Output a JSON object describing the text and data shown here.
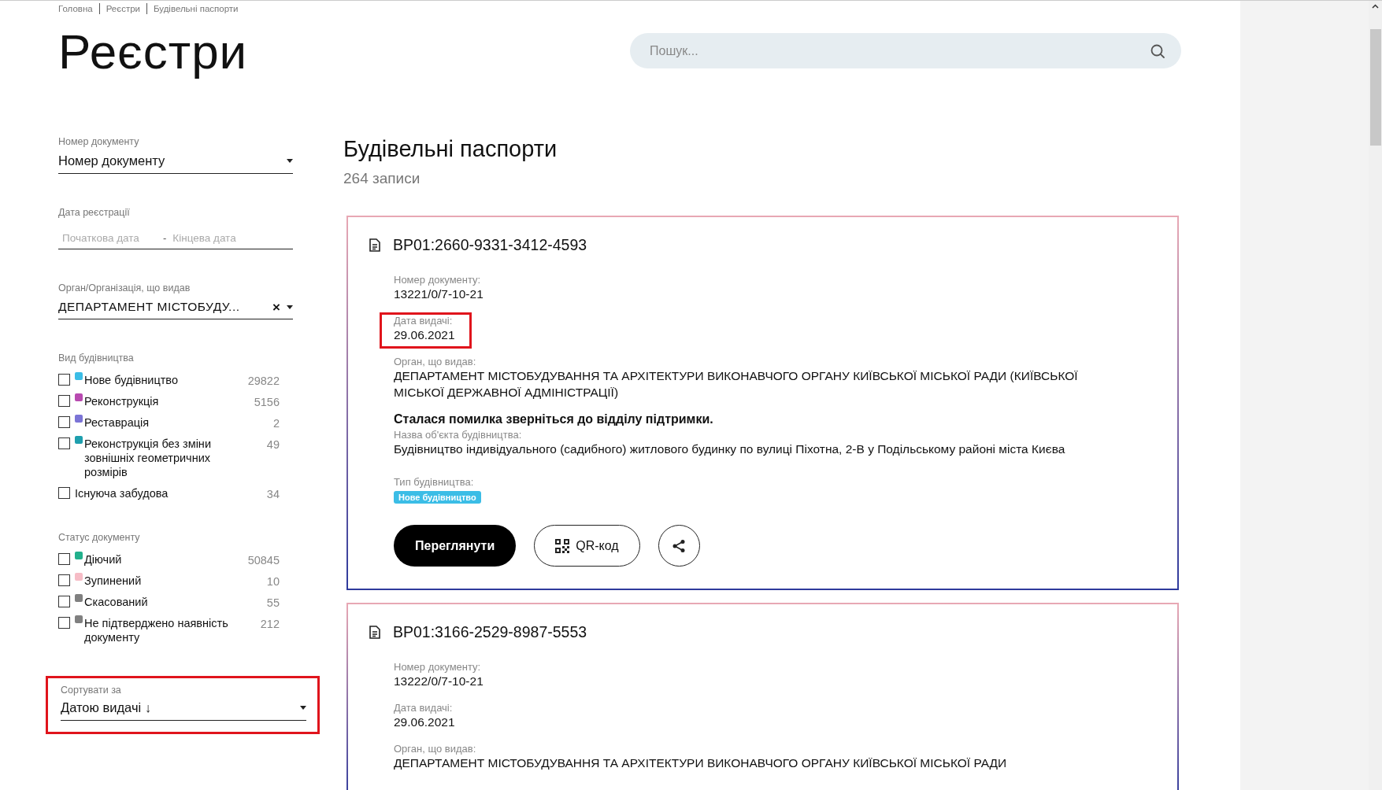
{
  "breadcrumbs": [
    "Головна",
    "Реєстри",
    "Будівельні паспорти"
  ],
  "page_title": "Реєстри",
  "search": {
    "placeholder": "Пошук..."
  },
  "filters": {
    "doc_number": {
      "label": "Номер документу",
      "value": "Номер документу"
    },
    "reg_date": {
      "label": "Дата реєстрації",
      "from_placeholder": "Початкова дата",
      "separator": "-",
      "to_placeholder": "Кінцева дата"
    },
    "issuer": {
      "label": "Орган/Організація, що видав",
      "value": "ДЕПАРТАМЕНТ МІСТОБУДУ...",
      "clear": "×"
    },
    "groups": [
      {
        "title": "Вид будівництва",
        "items": [
          {
            "label": "Нове будівництво",
            "count": "29822",
            "color": "#3bbde6",
            "checked": false
          },
          {
            "label": "Реконструкція",
            "count": "5156",
            "color": "#b84ab0",
            "checked": false
          },
          {
            "label": "Реставрація",
            "count": "2",
            "color": "#7b74d6",
            "checked": false
          },
          {
            "label": "Реконструкція без зміни зовнішніх геометричних розмірів",
            "count": "49",
            "color": "#1e9fae",
            "checked": false
          },
          {
            "label": "Існуюча забудова",
            "count": "34",
            "checked": false
          }
        ]
      },
      {
        "title": "Статус документу",
        "items": [
          {
            "label": "Діючий",
            "count": "50845",
            "color": "#22b08c",
            "checked": false
          },
          {
            "label": "Зупинений",
            "count": "10",
            "color": "#f6bcc6",
            "checked": false
          },
          {
            "label": "Скасований",
            "count": "55",
            "color": "#808080",
            "checked": false
          },
          {
            "label": "Не підтверджено наявність документу",
            "count": "212",
            "color": "#808080",
            "checked": false
          }
        ]
      }
    ],
    "sort": {
      "label": "Сортувати за",
      "value": "Датою видачі ↓",
      "highlighted": true
    }
  },
  "results": {
    "title": "Будівельні паспорти",
    "count": "264 записи",
    "cards": [
      {
        "id": "BP01:2660-9331-3412-4593",
        "fields": [
          {
            "label": "Номер документу:",
            "value": "13221/0/7-10-21",
            "highlighted": false
          },
          {
            "label": "Дата видачі:",
            "value": "29.06.2021",
            "highlighted": true
          },
          {
            "label": "Орган, що видав:",
            "value": "ДЕПАРТАМЕНТ МІСТОБУДУВАННЯ ТА АРХІТЕКТУРИ ВИКОНАВЧОГО ОРГАНУ КИЇВСЬКОЇ МІСЬКОЇ РАДИ (КИЇВСЬКОЇ МІСЬКОЇ ДЕРЖАВНОЇ АДМІНІСТРАЦІЇ)",
            "highlighted": false
          }
        ],
        "error": "Сталася помилка зверніться до відділу підтримки.",
        "object": {
          "label": "Назва об'єкта будівництва:",
          "value": "Будівництво індивідуального (садибного) житлового будинку по вулиці Піхотна, 2-В у Подільському районі міста Києва"
        },
        "type": {
          "label": "Тип будівництва:",
          "tag": "Нове будівництво",
          "color": "#3bbde6"
        },
        "actions": {
          "view": "Переглянути",
          "qr": "QR-код"
        }
      },
      {
        "id": "BP01:3166-2529-8987-5553",
        "fields": [
          {
            "label": "Номер документу:",
            "value": "13222/0/7-10-21",
            "highlighted": false
          },
          {
            "label": "Дата видачі:",
            "value": "29.06.2021",
            "highlighted": false
          },
          {
            "label": "Орган, що видав:",
            "value": "ДЕПАРТАМЕНТ МІСТОБУДУВАННЯ ТА АРХІТЕКТУРИ ВИКОНАВЧОГО ОРГАНУ КИЇВСЬКОЇ МІСЬКОЇ РАДИ",
            "highlighted": false
          }
        ]
      }
    ]
  }
}
